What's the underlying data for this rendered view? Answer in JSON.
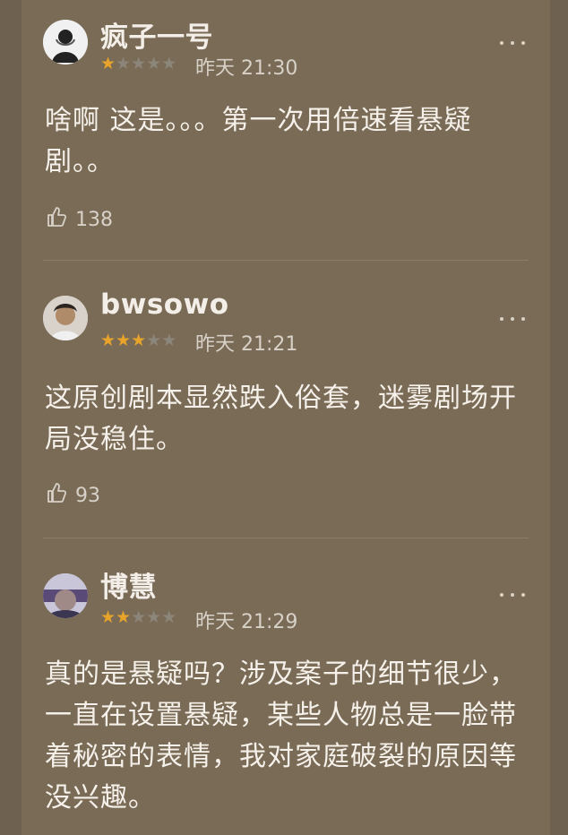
{
  "reviews": [
    {
      "username": "疯子一号",
      "rating": 1,
      "time": "昨天 21:30",
      "text": "啥啊 这是。。。第一次用倍速看悬疑剧。。",
      "likes": "138"
    },
    {
      "username": "bwsowo",
      "rating": 3,
      "time": "昨天 21:21",
      "text": "这原创剧本显然跌入俗套，迷雾剧场开局没稳住。",
      "likes": "93"
    },
    {
      "username": "博慧",
      "rating": 2,
      "time": "昨天 21:29",
      "text": "真的是悬疑吗？涉及案子的细节很少，一直在设置悬疑，某些人物总是一脸带着秘密的表情，我对家庭破裂的原因等没兴趣。",
      "likes": ""
    }
  ],
  "colors": {
    "background": "#7a6b57",
    "star_on": "#e8a42a",
    "star_off": "#8c857a",
    "text": "#f5f1ea"
  },
  "icons": {
    "more": "more-icon",
    "like": "thumbs-up-icon",
    "star": "star-icon"
  }
}
